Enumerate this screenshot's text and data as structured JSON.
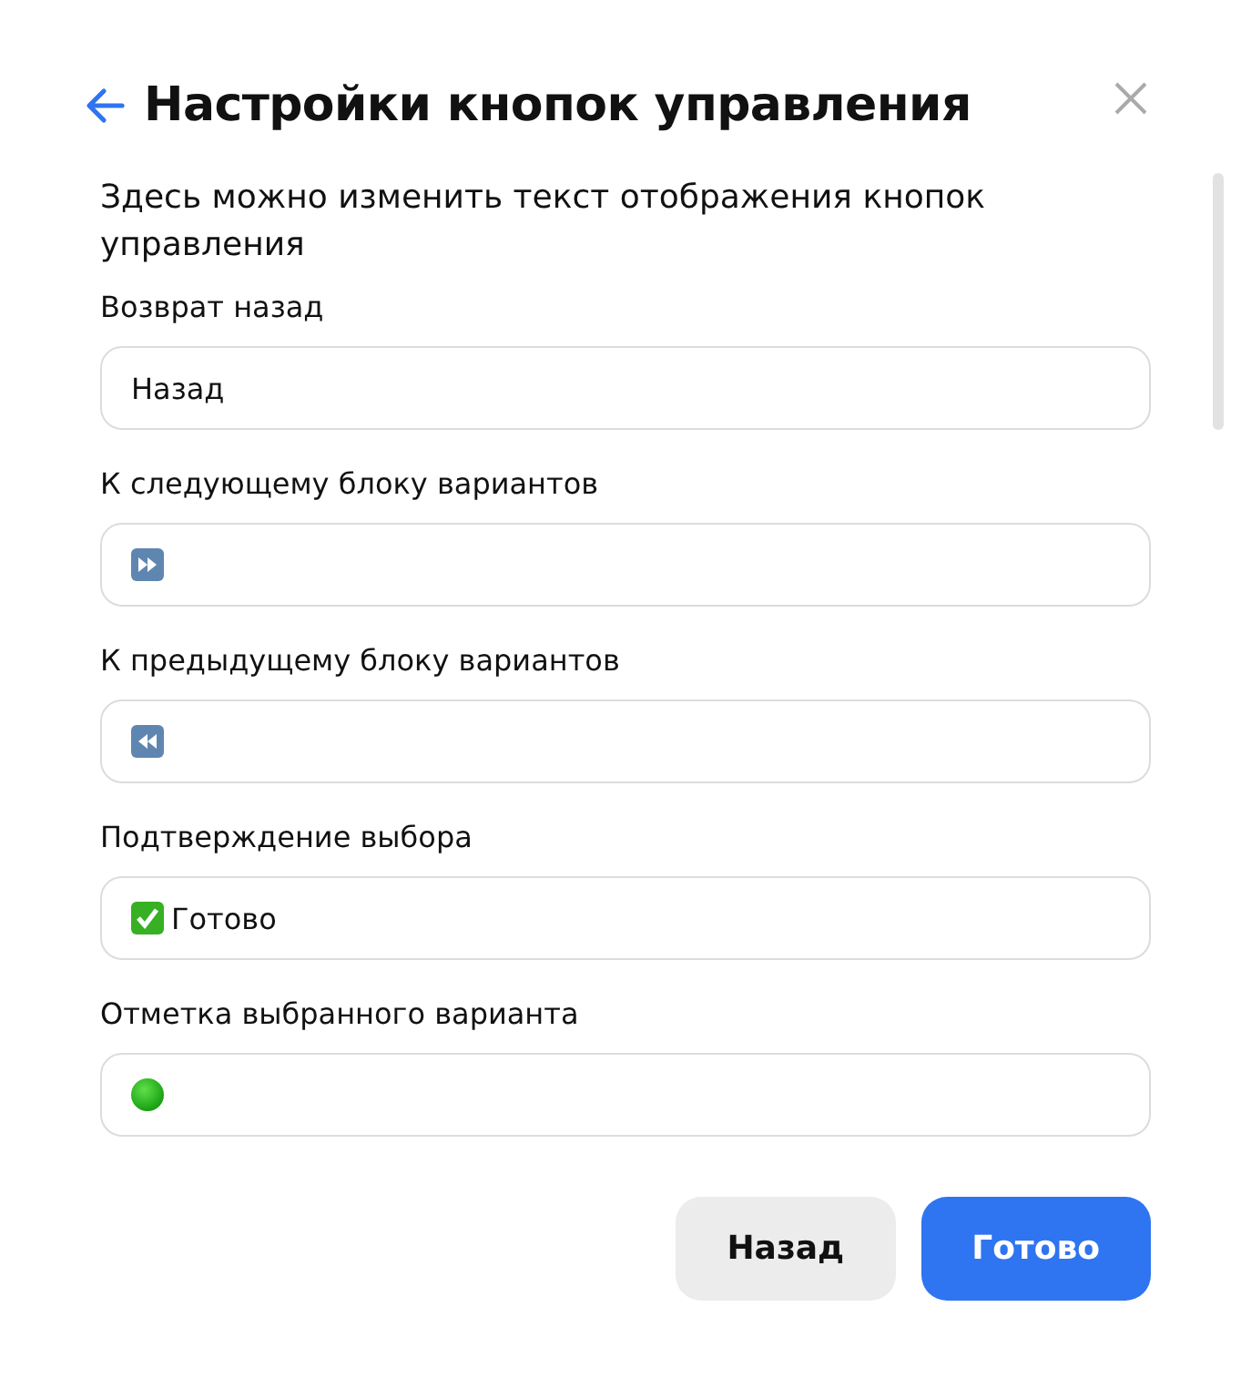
{
  "header": {
    "title": "Настройки кнопок управления"
  },
  "description": "Здесь можно изменить текст отображения кнопок управления",
  "fields": [
    {
      "label": "Возврат назад",
      "kind": "text",
      "value": "Назад"
    },
    {
      "label": "К следующему блоку вариантов",
      "kind": "forward"
    },
    {
      "label": "К предыдущему блоку вариантов",
      "kind": "rewind"
    },
    {
      "label": "Подтверждение выбора",
      "kind": "check",
      "value": "Готово"
    },
    {
      "label": "Отметка выбранного варианта",
      "kind": "dot"
    }
  ],
  "buttons": [
    {
      "label": "Назад",
      "kind": "secondary"
    },
    {
      "label": "Готово",
      "kind": "primary"
    }
  ]
}
